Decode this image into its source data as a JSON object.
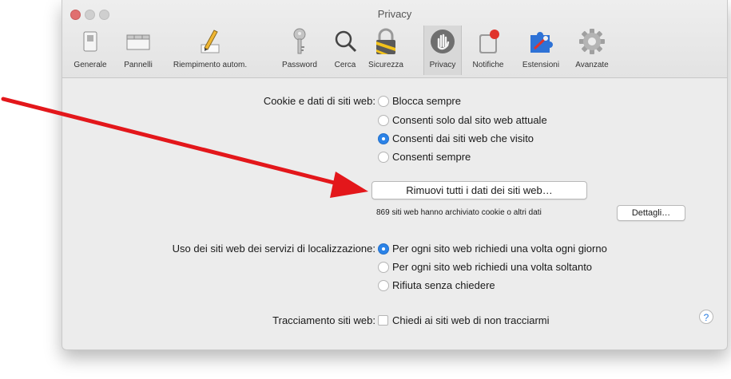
{
  "window": {
    "title": "Privacy"
  },
  "toolbar": {
    "items": [
      {
        "label": "Generale",
        "icon": "switch-icon"
      },
      {
        "label": "Pannelli",
        "icon": "tabs-icon"
      },
      {
        "label": "Riempimento autom.",
        "icon": "pencil-icon"
      },
      {
        "label": "Password",
        "icon": "key-icon"
      },
      {
        "label": "Cerca",
        "icon": "search-icon"
      },
      {
        "label": "Sicurezza",
        "icon": "lock-icon"
      },
      {
        "label": "Privacy",
        "icon": "hand-icon"
      },
      {
        "label": "Notifiche",
        "icon": "notification-icon"
      },
      {
        "label": "Estensioni",
        "icon": "puzzle-icon"
      },
      {
        "label": "Avanzate",
        "icon": "gear-icon"
      }
    ],
    "selected": "Privacy"
  },
  "cookies": {
    "label": "Cookie e dati di siti web:",
    "options": [
      "Blocca sempre",
      "Consenti solo dal sito web attuale",
      "Consenti dai siti web che visito",
      "Consenti sempre"
    ],
    "selected_index": 2,
    "remove_button": "Rimuovi tutti i dati dei siti web…",
    "stored_note": "869 siti web hanno archiviato cookie o altri dati",
    "details_button": "Dettagli…"
  },
  "location": {
    "label": "Uso dei siti web dei servizi di localizzazione:",
    "options": [
      "Per ogni sito web richiedi una volta ogni giorno",
      "Per ogni sito web richiedi una volta soltanto",
      "Rifiuta senza chiedere"
    ],
    "selected_index": 0
  },
  "tracking": {
    "label": "Tracciamento siti web:",
    "checkbox_label": "Chiedi ai siti web di non tracciarmi",
    "checked": false
  },
  "help": {
    "symbol": "?"
  },
  "colors": {
    "accent": "#2b83e8",
    "arrow": "#e3171b",
    "window_bg": "#ececec"
  }
}
